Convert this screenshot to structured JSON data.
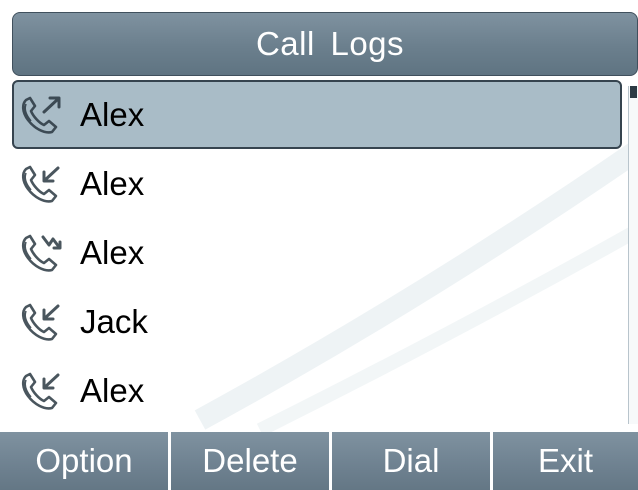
{
  "header": {
    "title": "Call  Logs"
  },
  "call_log": {
    "items": [
      {
        "name": "Alex",
        "icon": "outgoing-call-icon",
        "selected": true
      },
      {
        "name": "Alex",
        "icon": "incoming-call-icon",
        "selected": false
      },
      {
        "name": "Alex",
        "icon": "missed-call-icon",
        "selected": false
      },
      {
        "name": "Jack",
        "icon": "incoming-call-icon",
        "selected": false
      },
      {
        "name": "Alex",
        "icon": "incoming-call-icon",
        "selected": false
      }
    ]
  },
  "softkeys": {
    "option": "Option",
    "delete": "Delete",
    "dial": "Dial",
    "exit": "Exit"
  },
  "colors": {
    "title_bar": "#6b7f8d",
    "selected_row": "#a9bcc7",
    "softkey": "#6e8190"
  }
}
